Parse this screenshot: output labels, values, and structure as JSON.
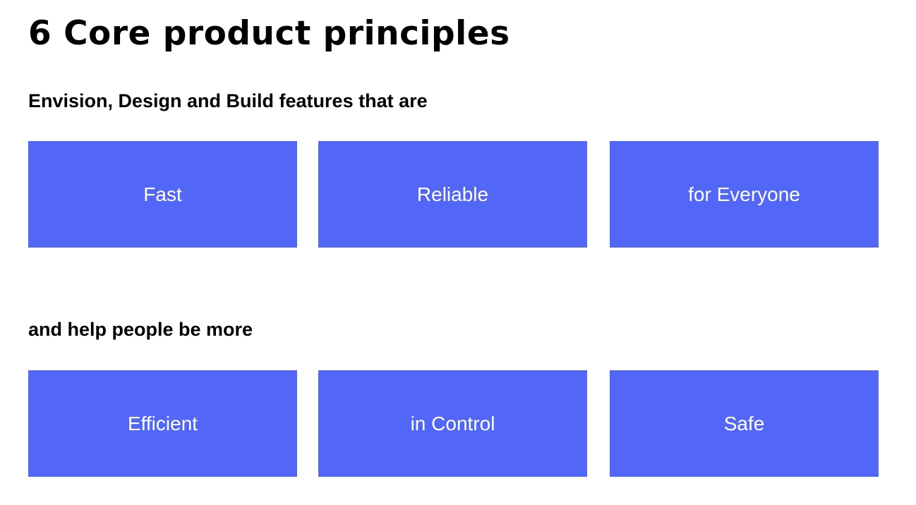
{
  "title": "6 Core product principles",
  "card_color": "#5266F7",
  "section_top": {
    "heading": "Envision, Design and Build features that are",
    "cards": [
      {
        "label": "Fast"
      },
      {
        "label": "Reliable"
      },
      {
        "label": "for Everyone"
      }
    ]
  },
  "section_bottom": {
    "heading": "and help people be more",
    "cards": [
      {
        "label": "Efficient"
      },
      {
        "label": "in Control"
      },
      {
        "label": "Safe"
      }
    ]
  }
}
